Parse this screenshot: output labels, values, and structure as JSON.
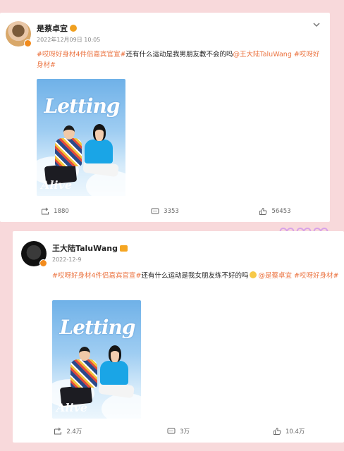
{
  "posts": [
    {
      "username": "是蔡卓宜",
      "time": "2022年12月09日 10:05",
      "content_parts": [
        {
          "text": "#哎呀好身材4件侣嘉宾官宣#",
          "hl": true
        },
        {
          "text": "还有什么运动是我男朋友教不会的吗",
          "hl": false
        },
        {
          "text": "@王大陆TaluWang",
          "hl": true
        },
        {
          "text": " ",
          "hl": false
        },
        {
          "text": "#哎呀好身材#",
          "hl": true
        }
      ],
      "poster_title": "Letting",
      "poster_sub": "Alive",
      "reposts": "1880",
      "comments": "3353",
      "likes": "56453"
    },
    {
      "username": "王大陆TaluWang",
      "time": "2022-12-9",
      "content_parts": [
        {
          "text": "#哎呀好身材4件侣嘉宾官宣#",
          "hl": true
        },
        {
          "text": "还有什么运动是我女朋友练不好的吗",
          "hl": false
        },
        {
          "text": "@是蔡卓宜",
          "hl": true
        },
        {
          "text": " ",
          "hl": false
        },
        {
          "text": "#哎呀好身材#",
          "hl": true
        }
      ],
      "poster_title": "Letting",
      "poster_sub": "Alive",
      "reposts": "2.4万",
      "comments": "3万",
      "likes": "10.4万"
    }
  ],
  "icons": {
    "repost": "repost-icon",
    "comment": "comment-icon",
    "like": "like-icon",
    "more": "chevron-down-icon",
    "decoration": "heart-outline-icon"
  },
  "colors": {
    "background": "#f8d9db",
    "highlight": "#eb7340",
    "badge": "#f28b1c",
    "heart": "#d8a2e8"
  }
}
